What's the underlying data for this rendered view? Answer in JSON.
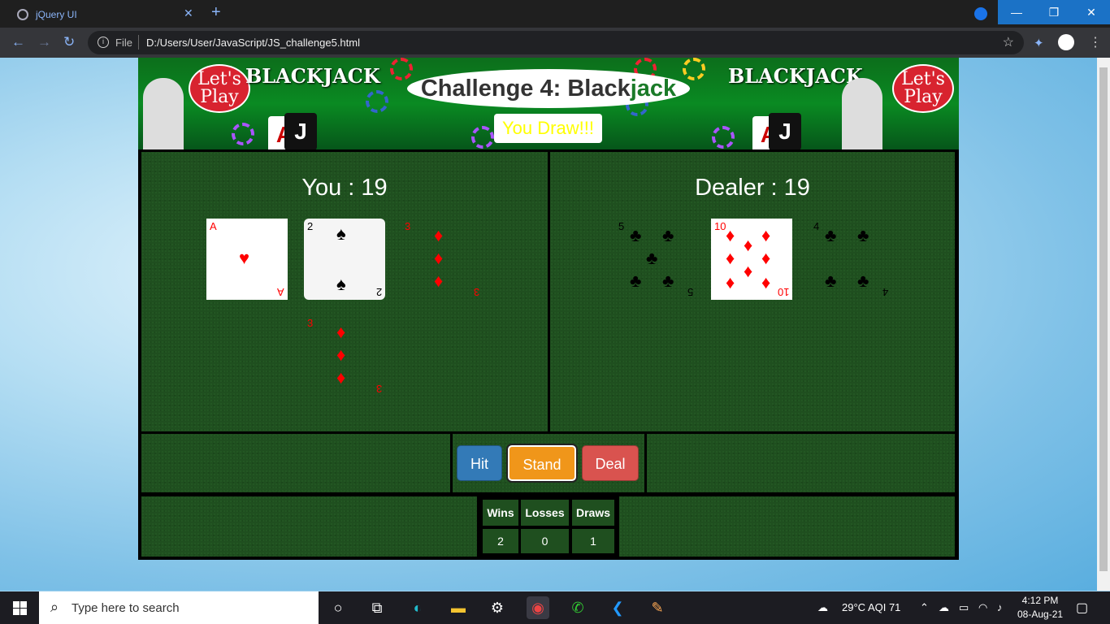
{
  "browser": {
    "tab_title": "jQuery UI",
    "tab_close": "✕",
    "new_tab": "+",
    "file_label": "File",
    "url": "D:/Users/User/JavaScript/JS_challenge5.html",
    "window_min": "—",
    "window_max": "❐",
    "window_close": "✕"
  },
  "banner": {
    "logo_text": "BLACKJACK",
    "lets_play": "Let's Play",
    "title_main": "Challenge 4: Black",
    "title_accent": "jack",
    "result": "You Draw!!!"
  },
  "player": {
    "label": "You : 19",
    "cards": [
      {
        "rank": "A",
        "suit": "♥",
        "color": "red"
      },
      {
        "rank": "2",
        "suit": "♠",
        "color": "black"
      },
      {
        "rank": "3",
        "suit": "♦",
        "color": "red"
      },
      {
        "rank": "3",
        "suit": "♦",
        "color": "red"
      }
    ]
  },
  "dealer": {
    "label": "Dealer : 19",
    "cards": [
      {
        "rank": "5",
        "suit": "♣",
        "color": "black"
      },
      {
        "rank": "10",
        "suit": "♦",
        "color": "red"
      },
      {
        "rank": "4",
        "suit": "♣",
        "color": "black"
      }
    ]
  },
  "buttons": {
    "hit": "Hit",
    "stand": "Stand",
    "deal": "Deal"
  },
  "scoreboard": {
    "headers": [
      "Wins",
      "Losses",
      "Draws"
    ],
    "values": [
      "2",
      "0",
      "1"
    ]
  },
  "taskbar": {
    "search_placeholder": "Type here to search",
    "weather": "29°C  AQI 71",
    "time": "4:12 PM",
    "date": "08-Aug-21"
  },
  "colors": {
    "felt": "#1f4f1f",
    "hit": "#337ab7",
    "stand": "#f0961a",
    "deal": "#d9534f",
    "title_accent": "#1a7a28"
  }
}
